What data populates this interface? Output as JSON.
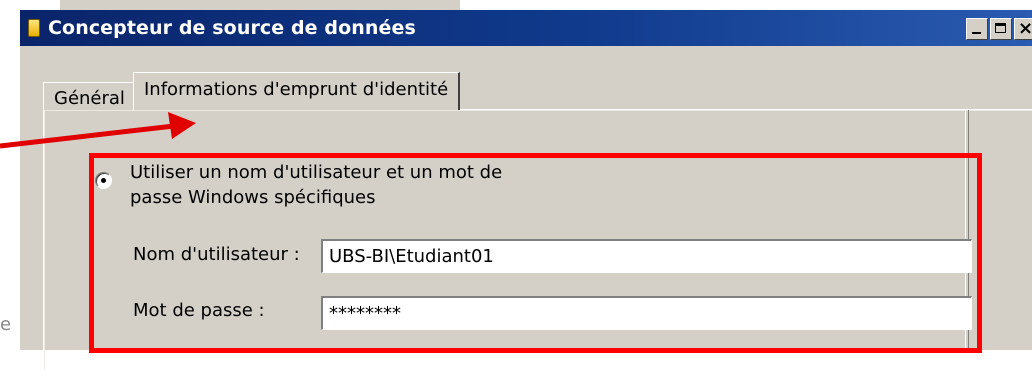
{
  "window": {
    "title": "Concepteur de source de données"
  },
  "tabs": [
    {
      "label": "Général",
      "active": false
    },
    {
      "label": "Informations d'emprunt d'identité",
      "active": true
    }
  ],
  "impersonation": {
    "option_label": "Utiliser un nom d'utilisateur et un mot de passe Windows spécifiques",
    "option_selected": true,
    "username_label": "Nom d'utilisateur :",
    "username_value": "UBS-BI\\Etudiant01",
    "password_label": "Mot de passe :",
    "password_value": "********"
  },
  "annotation": {
    "highlight_color": "#ff0000",
    "arrow_color": "#e00000"
  },
  "edge_text": "e"
}
